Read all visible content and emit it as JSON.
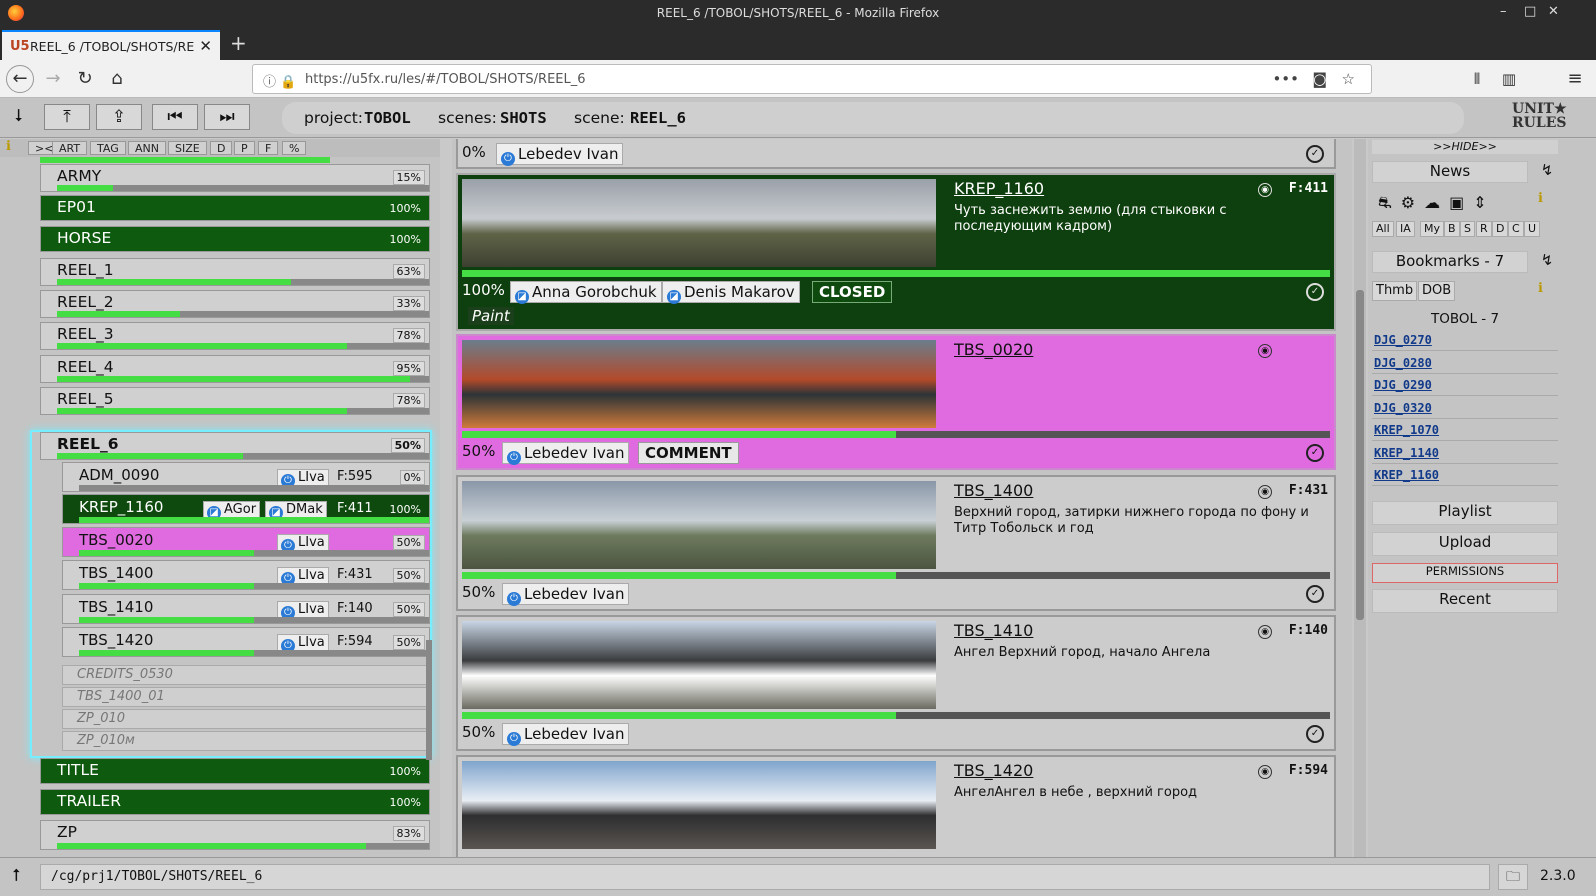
{
  "window": {
    "title": "REEL_6 /TOBOL/SHOTS/REEL_6 - Mozilla Firefox"
  },
  "tab": {
    "label": "REEL_6 /TOBOL/SHOTS/RE",
    "favicon": "U5"
  },
  "url": "https://u5fx.ru/les/#/TOBOL/SHOTS/REEL_6",
  "crumbs": {
    "project_label": "project:",
    "project": "TOBOL",
    "scenes_label": "scenes:",
    "scenes": "SHOTS",
    "scene_label": "scene:",
    "scene": "REEL_6"
  },
  "logo": {
    "line1": "UNIT★",
    "line2": "RULES"
  },
  "left_tools": [
    "><",
    "ART",
    "TAG",
    "ANN",
    "SIZE",
    "D",
    "P",
    "F",
    "%"
  ],
  "scenes_list": [
    {
      "name": "ARMY",
      "pct": "15%",
      "fill": 0.15
    },
    {
      "name": "EP01",
      "pct": "100%",
      "fill": 1.0
    },
    {
      "name": "HORSE",
      "pct": "100%",
      "fill": 1.0
    },
    {
      "name": "REEL_1",
      "pct": "63%",
      "fill": 0.63
    },
    {
      "name": "REEL_2",
      "pct": "33%",
      "fill": 0.33
    },
    {
      "name": "REEL_3",
      "pct": "78%",
      "fill": 0.78
    },
    {
      "name": "REEL_4",
      "pct": "95%",
      "fill": 0.95
    },
    {
      "name": "REEL_5",
      "pct": "78%",
      "fill": 0.78
    },
    {
      "name": "REEL_6",
      "pct": "50%",
      "fill": 0.5
    }
  ],
  "shots_list": [
    {
      "name": "ADM_0090",
      "who": [
        "LIva"
      ],
      "frames": "F:595",
      "pct": "0%",
      "fill": 0.0
    },
    {
      "name": "KREP_1160",
      "who": [
        "AGor",
        "DMak"
      ],
      "frames": "F:411",
      "pct": "100%",
      "fill": 1.0
    },
    {
      "name": "TBS_0020",
      "who": [
        "LIva"
      ],
      "frames": "",
      "pct": "50%",
      "fill": 0.5
    },
    {
      "name": "TBS_1400",
      "who": [
        "LIva"
      ],
      "frames": "F:431",
      "pct": "50%",
      "fill": 0.5
    },
    {
      "name": "TBS_1410",
      "who": [
        "LIva"
      ],
      "frames": "F:140",
      "pct": "50%",
      "fill": 0.5
    },
    {
      "name": "TBS_1420",
      "who": [
        "LIva"
      ],
      "frames": "F:594",
      "pct": "50%",
      "fill": 0.5
    }
  ],
  "ghost_shots": [
    "CREDITS_0530",
    "TBS_1400_01",
    "ZP_010",
    "ZP_010м"
  ],
  "scenes_after": [
    {
      "name": "TITLE",
      "pct": "100%",
      "fill": 1.0
    },
    {
      "name": "TRAILER",
      "pct": "100%",
      "fill": 1.0
    },
    {
      "name": "ZP",
      "pct": "83%",
      "fill": 0.83
    }
  ],
  "top_stub": {
    "pct": "0%",
    "who": "Lebedev Ivan"
  },
  "cards": [
    {
      "title": "KREP_1160",
      "frames": "F:411",
      "desc": "Чуть заснежить землю (для стыковки с последующим кадром)",
      "pct": "100%",
      "fill": 1.0,
      "who": [
        "Anna Gorobchuk",
        "Denis Makarov"
      ],
      "status": "CLOSED",
      "tag": "Paint"
    },
    {
      "title": "TBS_0020",
      "frames": "",
      "desc": "",
      "pct": "50%",
      "fill": 0.5,
      "who": [
        "Lebedev Ivan"
      ],
      "status": "COMMENT"
    },
    {
      "title": "TBS_1400",
      "frames": "F:431",
      "desc": "Верхний город, затирки нижнего города по фону и Титр Тобольск и год",
      "pct": "50%",
      "fill": 0.5,
      "who": [
        "Lebedev Ivan"
      ]
    },
    {
      "title": "TBS_1410",
      "frames": "F:140",
      "desc": "Ангел Верхний город, начало Ангела",
      "pct": "50%",
      "fill": 0.5,
      "who": [
        "Lebedev Ivan"
      ]
    },
    {
      "title": "TBS_1420",
      "frames": "F:594",
      "desc": "АнгелАнгел в небе , верхний город",
      "pct": "",
      "fill": 0.5,
      "who": []
    }
  ],
  "right": {
    "hide": ">>HIDE>>",
    "news": "News",
    "filters": [
      "All",
      "IA",
      "My",
      "B",
      "S",
      "R",
      "D",
      "C",
      "U"
    ],
    "bookmarks": "Bookmarks - 7",
    "bm_modes": [
      "Thmb",
      "DOB"
    ],
    "group": "TOBOL - 7",
    "links": [
      "DJG_0270",
      "DJG_0280",
      "DJG_0290",
      "DJG_0320",
      "KREP_1070",
      "KREP_1140",
      "KREP_1160"
    ],
    "buttons": {
      "playlist": "Playlist",
      "upload": "Upload",
      "permissions": "PERMISSIONS",
      "recent": "Recent"
    }
  },
  "status": {
    "path": "/cg/prj1/TOBOL/SHOTS/REEL_6",
    "version": "2.3.0"
  }
}
